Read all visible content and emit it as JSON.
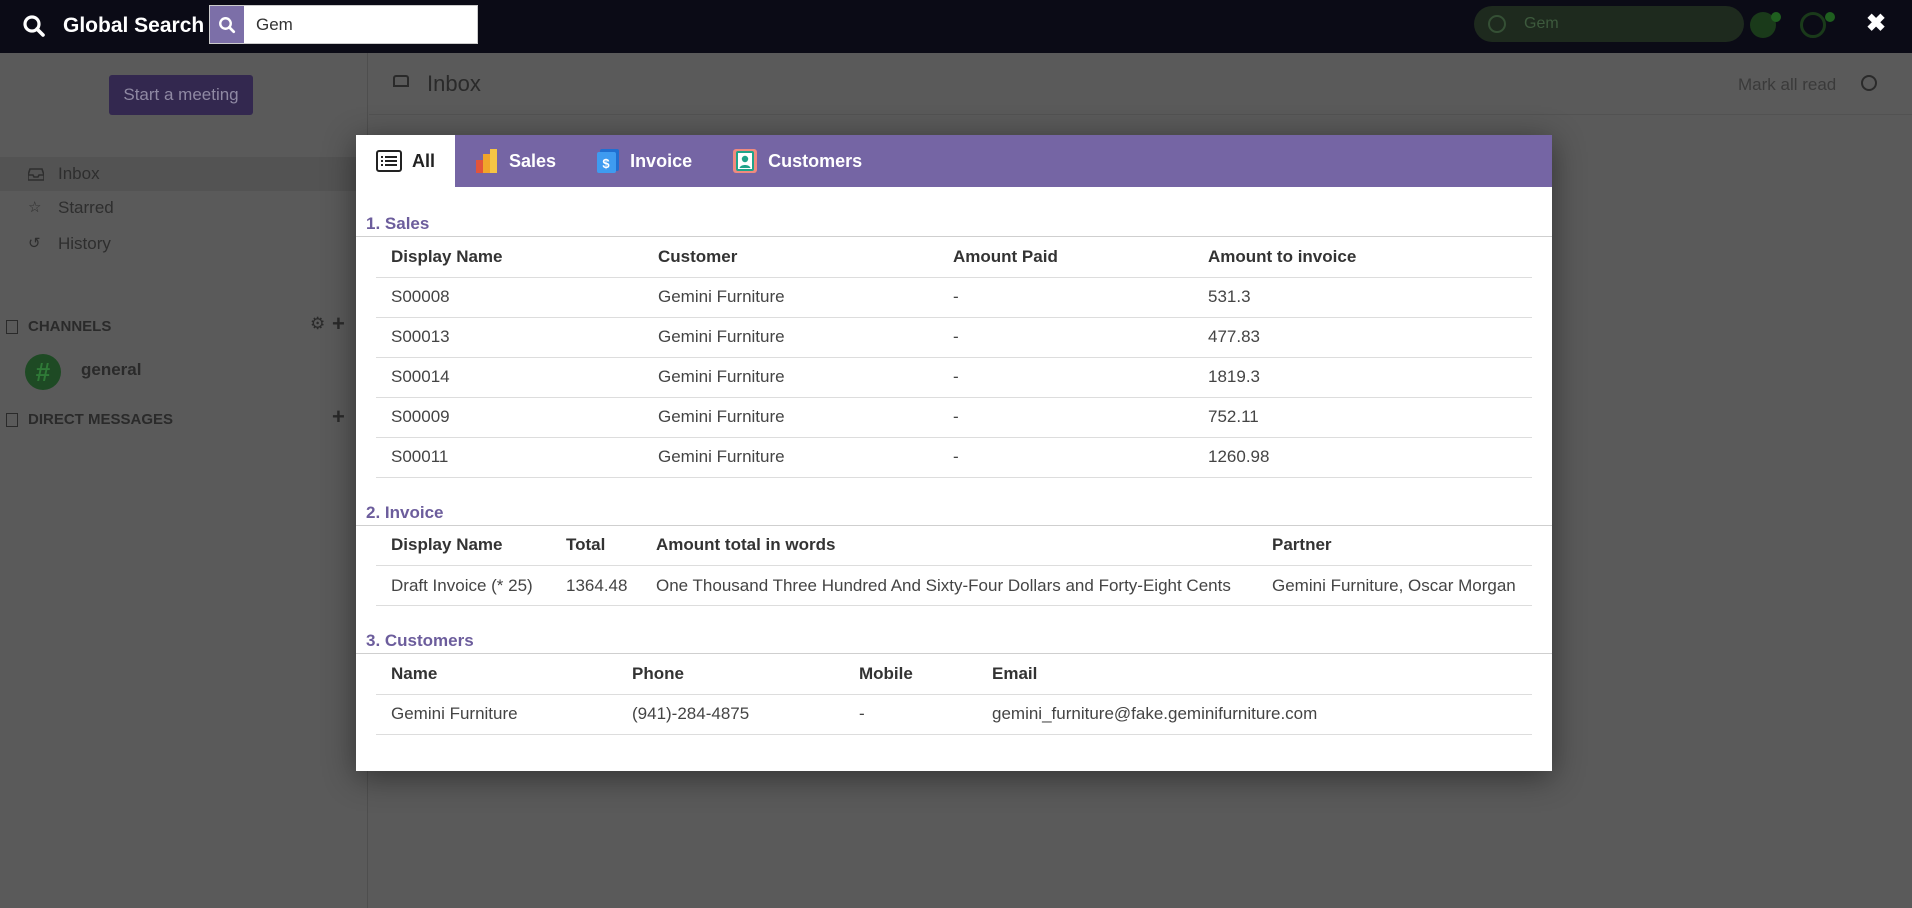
{
  "global_search": {
    "title": "Global Search",
    "query": "Gem",
    "close_label": "✖"
  },
  "background": {
    "topbar_search_value": "Gem",
    "meeting_button": "Start a meeting",
    "nav": [
      {
        "label": "Inbox",
        "icon": "inbox-icon"
      },
      {
        "label": "Starred",
        "icon": "star-icon"
      },
      {
        "label": "History",
        "icon": "history-icon"
      }
    ],
    "channels_heading": "CHANNELS",
    "channel_name": "general",
    "dm_heading": "DIRECT MESSAGES",
    "main_title": "Inbox",
    "mark_all_read": "Mark all read"
  },
  "tabs": [
    {
      "label": "All",
      "icon": "list-icon",
      "active": true
    },
    {
      "label": "Sales",
      "icon": "sales-chart-icon",
      "active": false
    },
    {
      "label": "Invoice",
      "icon": "invoice-icon",
      "active": false
    },
    {
      "label": "Customers",
      "icon": "customers-icon",
      "active": false
    }
  ],
  "sales": {
    "title": "1. Sales",
    "headers": [
      "Display Name",
      "Customer",
      "Amount Paid",
      "Amount to invoice"
    ],
    "rows": [
      [
        "S00008",
        "Gemini Furniture",
        "-",
        "531.3"
      ],
      [
        "S00013",
        "Gemini Furniture",
        "-",
        "477.83"
      ],
      [
        "S00014",
        "Gemini Furniture",
        "-",
        "1819.3"
      ],
      [
        "S00009",
        "Gemini Furniture",
        "-",
        "752.11"
      ],
      [
        "S00011",
        "Gemini Furniture",
        "-",
        "1260.98"
      ]
    ]
  },
  "invoice": {
    "title": "2. Invoice",
    "headers": [
      "Display Name",
      "Total",
      "Amount total in words",
      "Partner"
    ],
    "rows": [
      [
        "Draft Invoice (* 25)",
        "1364.48",
        "One Thousand Three Hundred And Sixty-Four Dollars and Forty-Eight Cents",
        "Gemini Furniture, Oscar Morgan"
      ]
    ]
  },
  "customers": {
    "title": "3. Customers",
    "headers": [
      "Name",
      "Phone",
      "Mobile",
      "Email"
    ],
    "rows": [
      [
        "Gemini Furniture",
        "(941)-284-4875",
        "-",
        "gemini_furniture@fake.geminifurniture.com"
      ]
    ]
  },
  "colors": {
    "accent": "#7565a4",
    "section_title": "#6c5d9c",
    "topbar": "#0b0b16"
  }
}
